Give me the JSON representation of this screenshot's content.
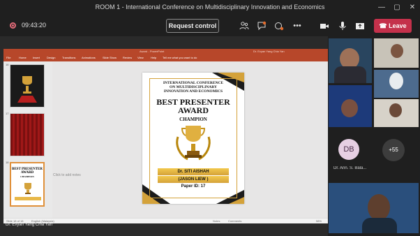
{
  "window": {
    "title": "ROOM 1 - International Conference on Multidisciplinary Innovation and Economics"
  },
  "toolbar": {
    "timer": "09:43:20",
    "request_control_label": "Request control",
    "leave_label": "Leave"
  },
  "powerpoint": {
    "title": "Award - PowerPoint",
    "user": "Dr. Evyan Yang Chia Yan",
    "ribbon_tabs": [
      "File",
      "Home",
      "Insert",
      "Design",
      "Transitions",
      "Animations",
      "Slide Show",
      "Review",
      "View",
      "Help",
      "Tell me what you want to do"
    ],
    "thumb_numbers": [
      "16",
      "17",
      "18"
    ],
    "add_notes": "Click to add notes",
    "status_slide": "Slide 18 of 18",
    "status_language": "English (Malaysia)",
    "status_notes": "Notes",
    "status_comments": "Comments",
    "status_zoom": "58%"
  },
  "slide": {
    "conference_line1": "INTERNATIONAL CONFERENCE",
    "conference_line2": "ON MULTIDISCIPLINARY",
    "conference_line3": "INNOVATION AND ECONOMICS",
    "award_line1": "BEST PRESENTER",
    "award_line2": "AWARD",
    "champion": "CHAMPION",
    "winner_name": "Dr. SITI AISHAH",
    "winner_alias": "(JASON LIEW )",
    "paper_id": "Paper ID: 17"
  },
  "thumb_slide": {
    "line1": "BEST PRESENTER",
    "line2": "AWARD",
    "line3": "CHAMPION"
  },
  "participants": {
    "avatar_initials": "DB",
    "avatar_name": "Dr. Ann. S. Bala...",
    "more_count": "+55",
    "presenter_name": "Dr. Evyan Yang Chia Yan"
  },
  "colors": {
    "leave": "#c4314b",
    "ppt": "#b7472a",
    "gold": "#d4a23a"
  }
}
